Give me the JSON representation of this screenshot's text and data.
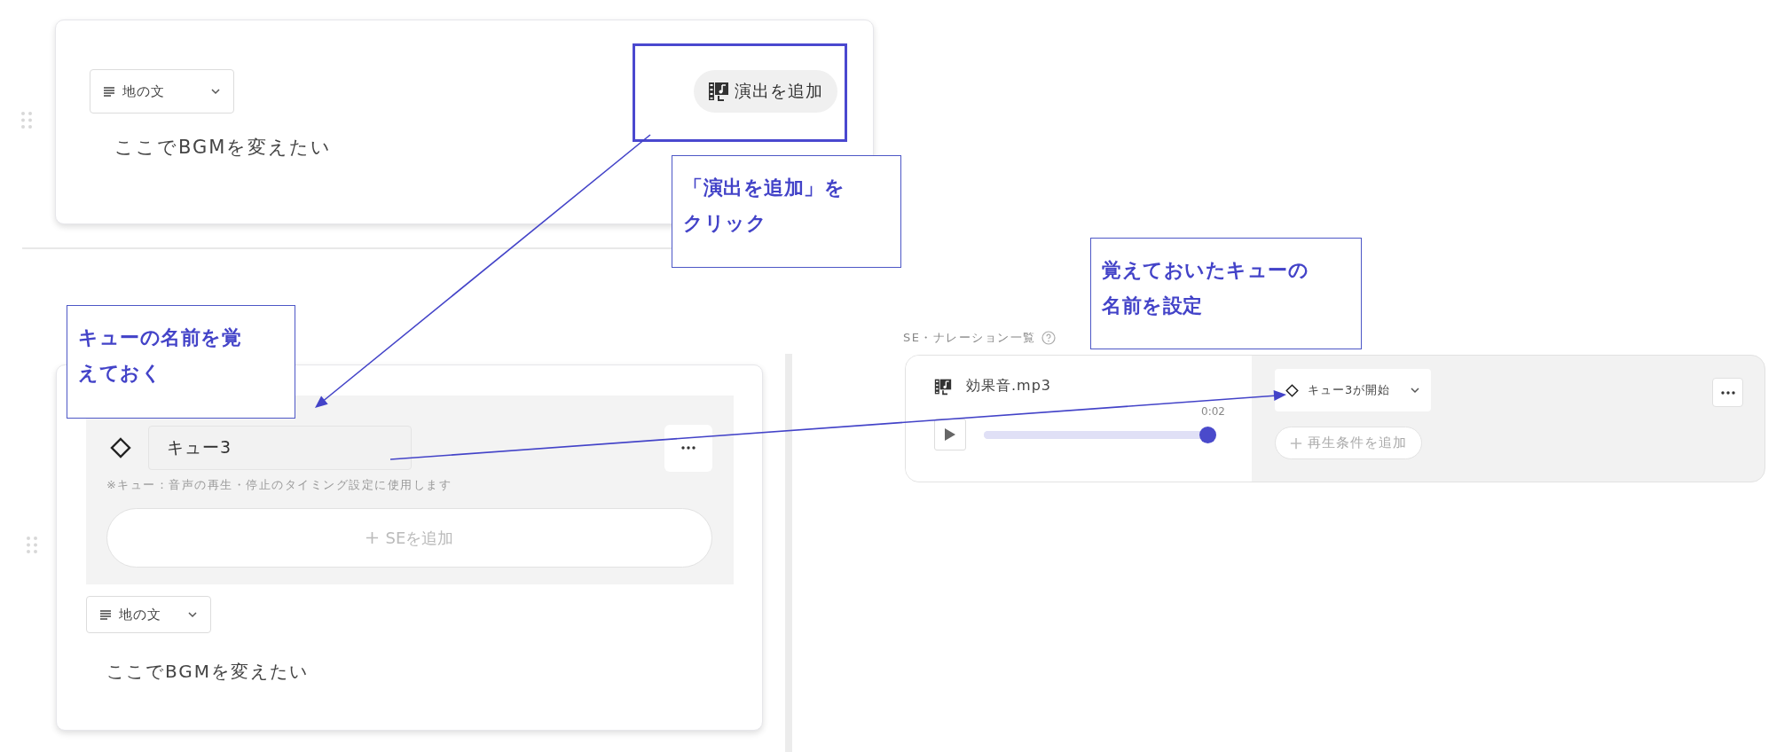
{
  "top_card": {
    "type_dropdown": "地の文",
    "text": "ここでBGMを変えたい",
    "add_effect_button": "演出を追加"
  },
  "cue_card": {
    "cue_name": "キュー3",
    "note": "※キュー：音声の再生・停止のタイミング設定に使用します",
    "add_se_button": "SEを追加",
    "type_dropdown": "地の文",
    "text": "ここでBGMを変えたい"
  },
  "se_list": {
    "title": "SE・ナレーション一覧",
    "items": [
      {
        "file": "効果音.mp3",
        "duration": "0:02",
        "level": 1,
        "condition": "キュー3が開始",
        "add_condition_button": "再生条件を追加"
      }
    ]
  },
  "annotations": [
    {
      "text": "「演出を追加」をクリック"
    },
    {
      "text": "キューの名前を覚えておく"
    },
    {
      "text": "覚えておいたキューの名前を設定"
    }
  ]
}
